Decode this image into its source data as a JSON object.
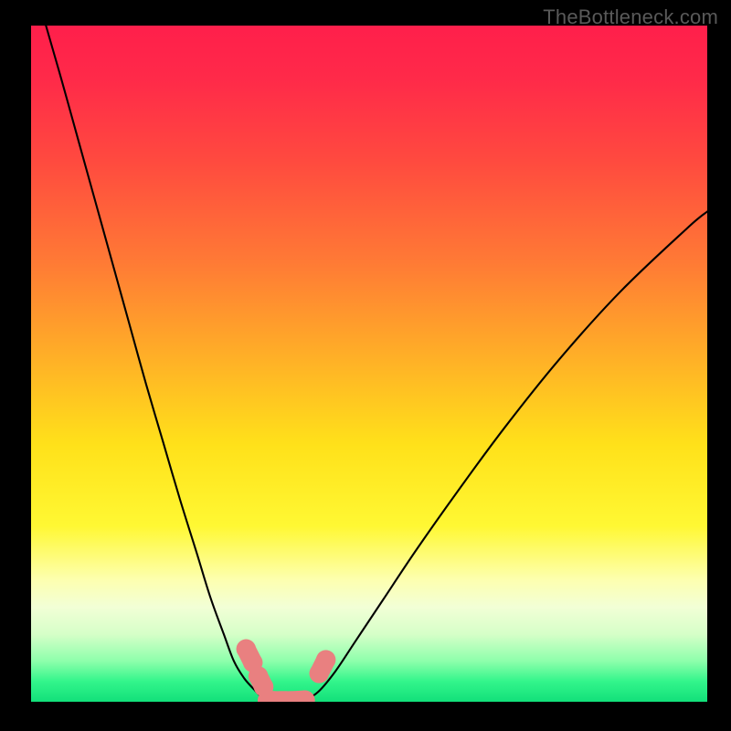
{
  "watermark": "TheBottleneck.com",
  "chart_data": {
    "type": "line",
    "title": "",
    "xlabel": "",
    "ylabel": "",
    "xlim": [
      0,
      100
    ],
    "ylim": [
      0,
      100
    ],
    "background_gradient": {
      "stops": [
        {
          "offset": 0.0,
          "color": "#ff1f4b"
        },
        {
          "offset": 0.08,
          "color": "#ff2a49"
        },
        {
          "offset": 0.2,
          "color": "#ff4a3f"
        },
        {
          "offset": 0.35,
          "color": "#ff7a35"
        },
        {
          "offset": 0.5,
          "color": "#ffb326"
        },
        {
          "offset": 0.62,
          "color": "#ffe11a"
        },
        {
          "offset": 0.74,
          "color": "#fff833"
        },
        {
          "offset": 0.82,
          "color": "#fdffb0"
        },
        {
          "offset": 0.86,
          "color": "#f2ffd6"
        },
        {
          "offset": 0.9,
          "color": "#d6ffc8"
        },
        {
          "offset": 0.94,
          "color": "#8dffab"
        },
        {
          "offset": 0.97,
          "color": "#33f58b"
        },
        {
          "offset": 1.0,
          "color": "#12e07a"
        }
      ]
    },
    "series": [
      {
        "name": "left-curve",
        "stroke": "#000000",
        "type": "bottleneck-curve",
        "x": [
          2.2,
          4.5,
          7.0,
          9.5,
          12.0,
          14.5,
          17.0,
          19.5,
          22.0,
          24.5,
          26.5,
          28.5,
          30.0,
          31.5,
          33.0,
          34.0,
          35.0
        ],
        "y": [
          100.0,
          92.0,
          83.0,
          74.0,
          65.0,
          56.0,
          47.0,
          38.5,
          30.0,
          22.0,
          15.5,
          10.0,
          6.0,
          3.5,
          1.8,
          0.8,
          0.2
        ]
      },
      {
        "name": "right-curve",
        "stroke": "#000000",
        "type": "bottleneck-curve",
        "x": [
          40.5,
          42.5,
          45.0,
          48.0,
          52.0,
          57.0,
          63.0,
          70.0,
          78.0,
          87.0,
          97.0,
          100.0
        ],
        "y": [
          0.2,
          1.5,
          4.5,
          9.0,
          15.0,
          22.5,
          31.0,
          40.5,
          50.5,
          60.5,
          70.0,
          72.5
        ]
      },
      {
        "name": "bottom-band",
        "stroke": "#e98080",
        "stroke_width": 22,
        "x": [
          35.0,
          36.0,
          37.3,
          38.5,
          40.5
        ],
        "y": [
          0.2,
          0.1,
          0.1,
          0.1,
          0.2
        ]
      },
      {
        "name": "left-blob-upper",
        "stroke": "#e98080",
        "type": "marker-cluster",
        "x": [
          31.8,
          32.8
        ],
        "y": [
          7.8,
          5.8
        ]
      },
      {
        "name": "left-blob-lower",
        "stroke": "#e98080",
        "type": "marker-cluster",
        "x": [
          33.6,
          34.4
        ],
        "y": [
          3.8,
          2.2
        ]
      },
      {
        "name": "right-blob",
        "stroke": "#e98080",
        "type": "marker-cluster",
        "x": [
          42.6,
          43.6
        ],
        "y": [
          4.2,
          6.2
        ]
      }
    ]
  }
}
